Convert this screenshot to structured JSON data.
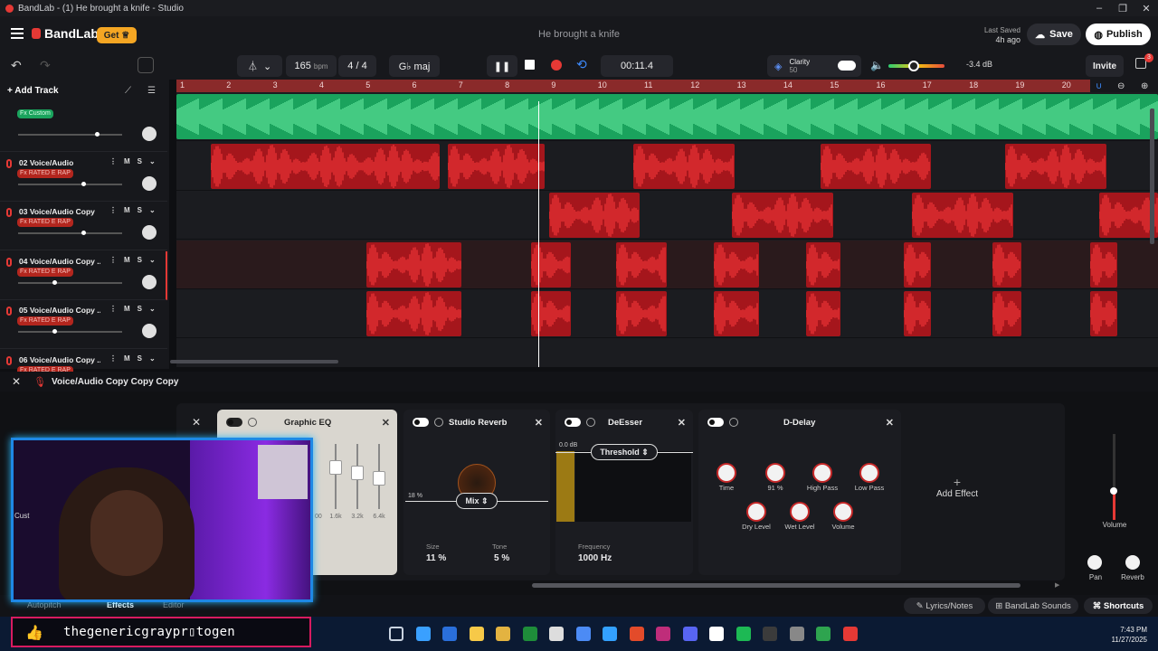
{
  "window": {
    "title": "BandLab - (1) He brought a knife - Studio"
  },
  "header": {
    "brand": "BandLab",
    "get_label": "Get",
    "project_title": "He brought a knife",
    "last_saved_label": "Last Saved",
    "last_saved_value": "4h ago",
    "save_label": "Save",
    "publish_label": "Publish"
  },
  "transport": {
    "bpm": "165",
    "bpm_unit": "bpm",
    "time_sig": "4 / 4",
    "key": "G♭ maj",
    "time": "00:11.4",
    "clarity_label": "Clarity",
    "clarity_value": "50",
    "volume_db": "-3.4 dB",
    "invite_label": "Invite",
    "notif_count": "3",
    "master_volume": 0.45
  },
  "ruler": {
    "bars": [
      "1",
      "2",
      "3",
      "4",
      "5",
      "6",
      "7",
      "8",
      "9",
      "10",
      "11",
      "12",
      "13",
      "14",
      "15",
      "16",
      "17",
      "18",
      "19",
      "20"
    ]
  },
  "tracks_panel": {
    "add_track_label": "Add Track"
  },
  "tracks": [
    {
      "name": "",
      "fx": "Fx Custom",
      "mute": "M",
      "solo": "S"
    },
    {
      "name": "02  Voice/Audio",
      "fx": "Fx RATED E RAP",
      "mute": "M",
      "solo": "S"
    },
    {
      "name": "03  Voice/Audio Copy",
      "fx": "Fx RATED E RAP",
      "mute": "M",
      "solo": "S"
    },
    {
      "name": "04  Voice/Audio Copy ...",
      "fx": "Fx RATED E RAP",
      "mute": "M",
      "solo": "S"
    },
    {
      "name": "05  Voice/Audio Copy ...",
      "fx": "Fx RATED E RAP",
      "mute": "M",
      "solo": "S"
    },
    {
      "name": "06  Voice/Audio Copy ...",
      "fx": "Fx RATED E RAP",
      "mute": "M",
      "solo": "S"
    }
  ],
  "effects": {
    "track_name": "Voice/Audio Copy Copy Copy",
    "graphic_eq": {
      "title": "Graphic EQ",
      "bands": [
        "1.6k",
        "3.2k",
        "6.4k"
      ],
      "band_partial": "00"
    },
    "reverb": {
      "title": "Studio Reverb",
      "mix_label": "Mix",
      "mix_value": "18 %",
      "size_label": "Size",
      "size_value": "11 %",
      "tone_label": "Tone",
      "tone_value": "5 %"
    },
    "deesser": {
      "title": "DeEsser",
      "threshold_label": "Threshold",
      "level": "0.0 dB",
      "freq_label": "Frequency",
      "freq_value": "1000 Hz"
    },
    "delay": {
      "title": "D-Delay",
      "knobs": [
        "Time",
        "91 %",
        "High Pass",
        "Low Pass"
      ],
      "knobs2": [
        "Dry Level",
        "Wet Level",
        "Volume"
      ]
    },
    "add_effect_label": "Add Effect",
    "volume_label": "Volume",
    "pan_label": "Pan",
    "reverb_label": "Reverb",
    "side_partial": "Cust"
  },
  "bottom": {
    "tabs": [
      "Autopitch",
      "Effects",
      "Editor"
    ],
    "lyrics_label": "Lyrics/Notes",
    "sounds_label": "BandLab Sounds",
    "shortcuts_label": "Shortcuts"
  },
  "stream": {
    "username": "thegenericgraypr▯togen"
  },
  "taskbar": {
    "time": "7:43 PM",
    "date": "11/27/2025"
  },
  "colors": {
    "accent": "#e53935",
    "clip_red": "#a5161c",
    "clip_green": "#1aa35d",
    "publish_bg": "#ffffff"
  }
}
